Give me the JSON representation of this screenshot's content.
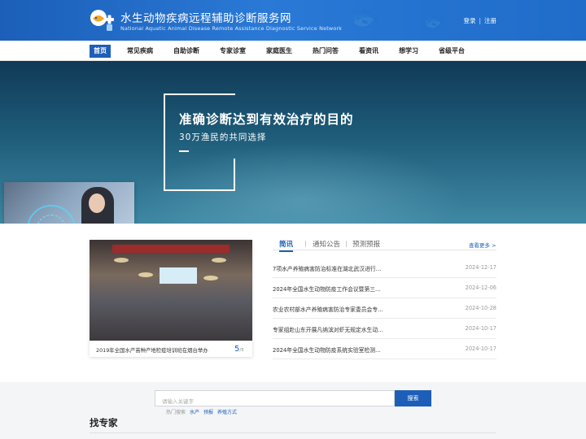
{
  "header": {
    "title": "水生动物疾病远程辅助诊断服务网",
    "subtitle": "National Aquatic Animal Disease Remote Assistance Diagnostic Service Network",
    "login": "登录",
    "separator": "|",
    "register": "注册"
  },
  "nav": {
    "items": [
      "首页",
      "常见疾病",
      "自助诊断",
      "专家诊室",
      "家庭医生",
      "热门问答",
      "看资讯",
      "想学习",
      "省级平台"
    ],
    "active_index": 0
  },
  "hero": {
    "title": "准确诊断达到有效治疗的目的",
    "subtitle": "30万渔民的共同选择"
  },
  "news_photo": {
    "caption": "2019年全国水产苗种产地检疫培训班在烟台举办",
    "count": "5",
    "count_unit": "/5"
  },
  "news_tabs": [
    "简讯",
    "通知公告",
    "预测预报"
  ],
  "news_more": "查看更多 >",
  "news": [
    {
      "title": "7项水产养殖病害防治标准在湖北武汉进行…",
      "date": "2024-12-17"
    },
    {
      "title": "2024年全国水生动物防疫工作会议暨第三…",
      "date": "2024-12-06"
    },
    {
      "title": "农业农村部水产养殖病害防治专家委员会专…",
      "date": "2024-10-28"
    },
    {
      "title": "专家组赴山东开展凡纳滨对虾无规定水生动…",
      "date": "2024-10-17"
    },
    {
      "title": "2024年全国水生动物防疫系统实验室检测…",
      "date": "2024-10-17"
    }
  ],
  "search": {
    "placeholder": "请输入关键字",
    "button": "搜索",
    "hot_label": "热门搜索",
    "hot_keywords": [
      "水产",
      "预报",
      "养殖方式"
    ]
  },
  "expert_section": {
    "title": "找专家"
  },
  "colors": {
    "brand_blue": "#1d5fb8",
    "header_blue": "#2a79d6",
    "hero_dark": "#103a57"
  }
}
